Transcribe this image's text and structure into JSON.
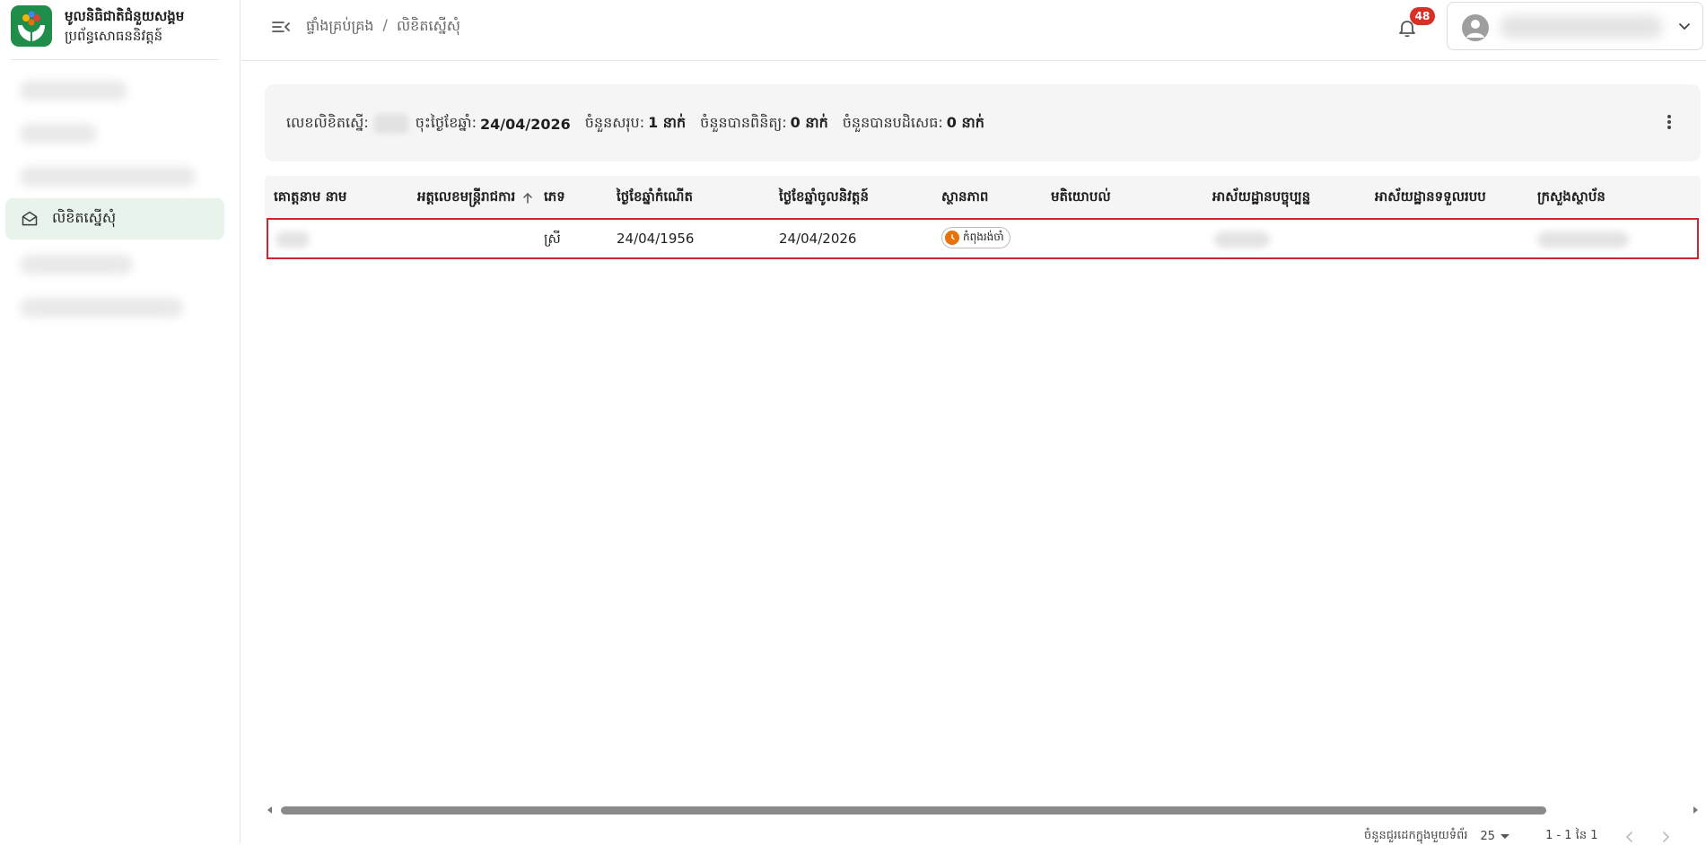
{
  "sidebar": {
    "brand_title": "មូលនិធិជាតិជំនួយសង្គម",
    "brand_subtitle": "ប្រព័ន្ធសោធននិវត្តន៍",
    "active_item_label": "លិខិតស្នើសុំ"
  },
  "topbar": {
    "breadcrumb_home": "ផ្ទាំងគ្រប់គ្រង",
    "breadcrumb_sep": "/",
    "breadcrumb_current": "លិខិតស្នើសុំ",
    "notification_count": "48"
  },
  "summary": {
    "request_no_label": "លេខលិខិតស្នើ:",
    "date_label": "ចុះថ្ងៃខែឆ្នាំ:",
    "date_value": "24/04/2026",
    "total_label": "ចំនួនសរុប:",
    "total_value": "1 នាក់",
    "verified_label": "ចំនួនបានពិនិត្យ:",
    "verified_value": "0 នាក់",
    "rejected_label": "ចំនួនបានបដិសេធ:",
    "rejected_value": "0 នាក់"
  },
  "table": {
    "columns": [
      "គោត្តនាម នាម",
      "អត្តលេខមន្ត្រីរាជការ",
      "ភេទ",
      "ថ្ងៃខែឆ្នាំកំណើត",
      "ថ្ងៃខែឆ្នាំចូលនិវត្តន៍",
      "ស្ថានភាព",
      "មតិយោបល់",
      "អាស័យដ្ឋានបច្ចុប្បន្ន",
      "អាស័យដ្ឋានទទួលរបប",
      "ក្រសួងស្ថាប័ន"
    ],
    "rows": [
      {
        "gender": "ស្រី",
        "birth_date": "24/04/1956",
        "retire_date": "24/04/2026",
        "status": "កំពុងរង់ចាំ"
      }
    ]
  },
  "paginator": {
    "items_per_page_label": "ចំនួនជួរដេកក្នុងមួយទំព័រ",
    "page_size": "25",
    "range_label": "1 - 1 នៃ 1"
  },
  "colors": {
    "brand_green": "#1e8e4a",
    "active_bg": "#e8f3ec",
    "badge_red": "#d93025",
    "status_orange": "#e8710a",
    "row_highlight": "#d8222a"
  },
  "icons": {
    "menu_toggle": "menu-open-icon",
    "notification": "bell-icon",
    "avatar": "person-icon",
    "active_menu": "mail-open-icon",
    "sort": "arrow-up-icon",
    "more": "more-vert-icon"
  }
}
